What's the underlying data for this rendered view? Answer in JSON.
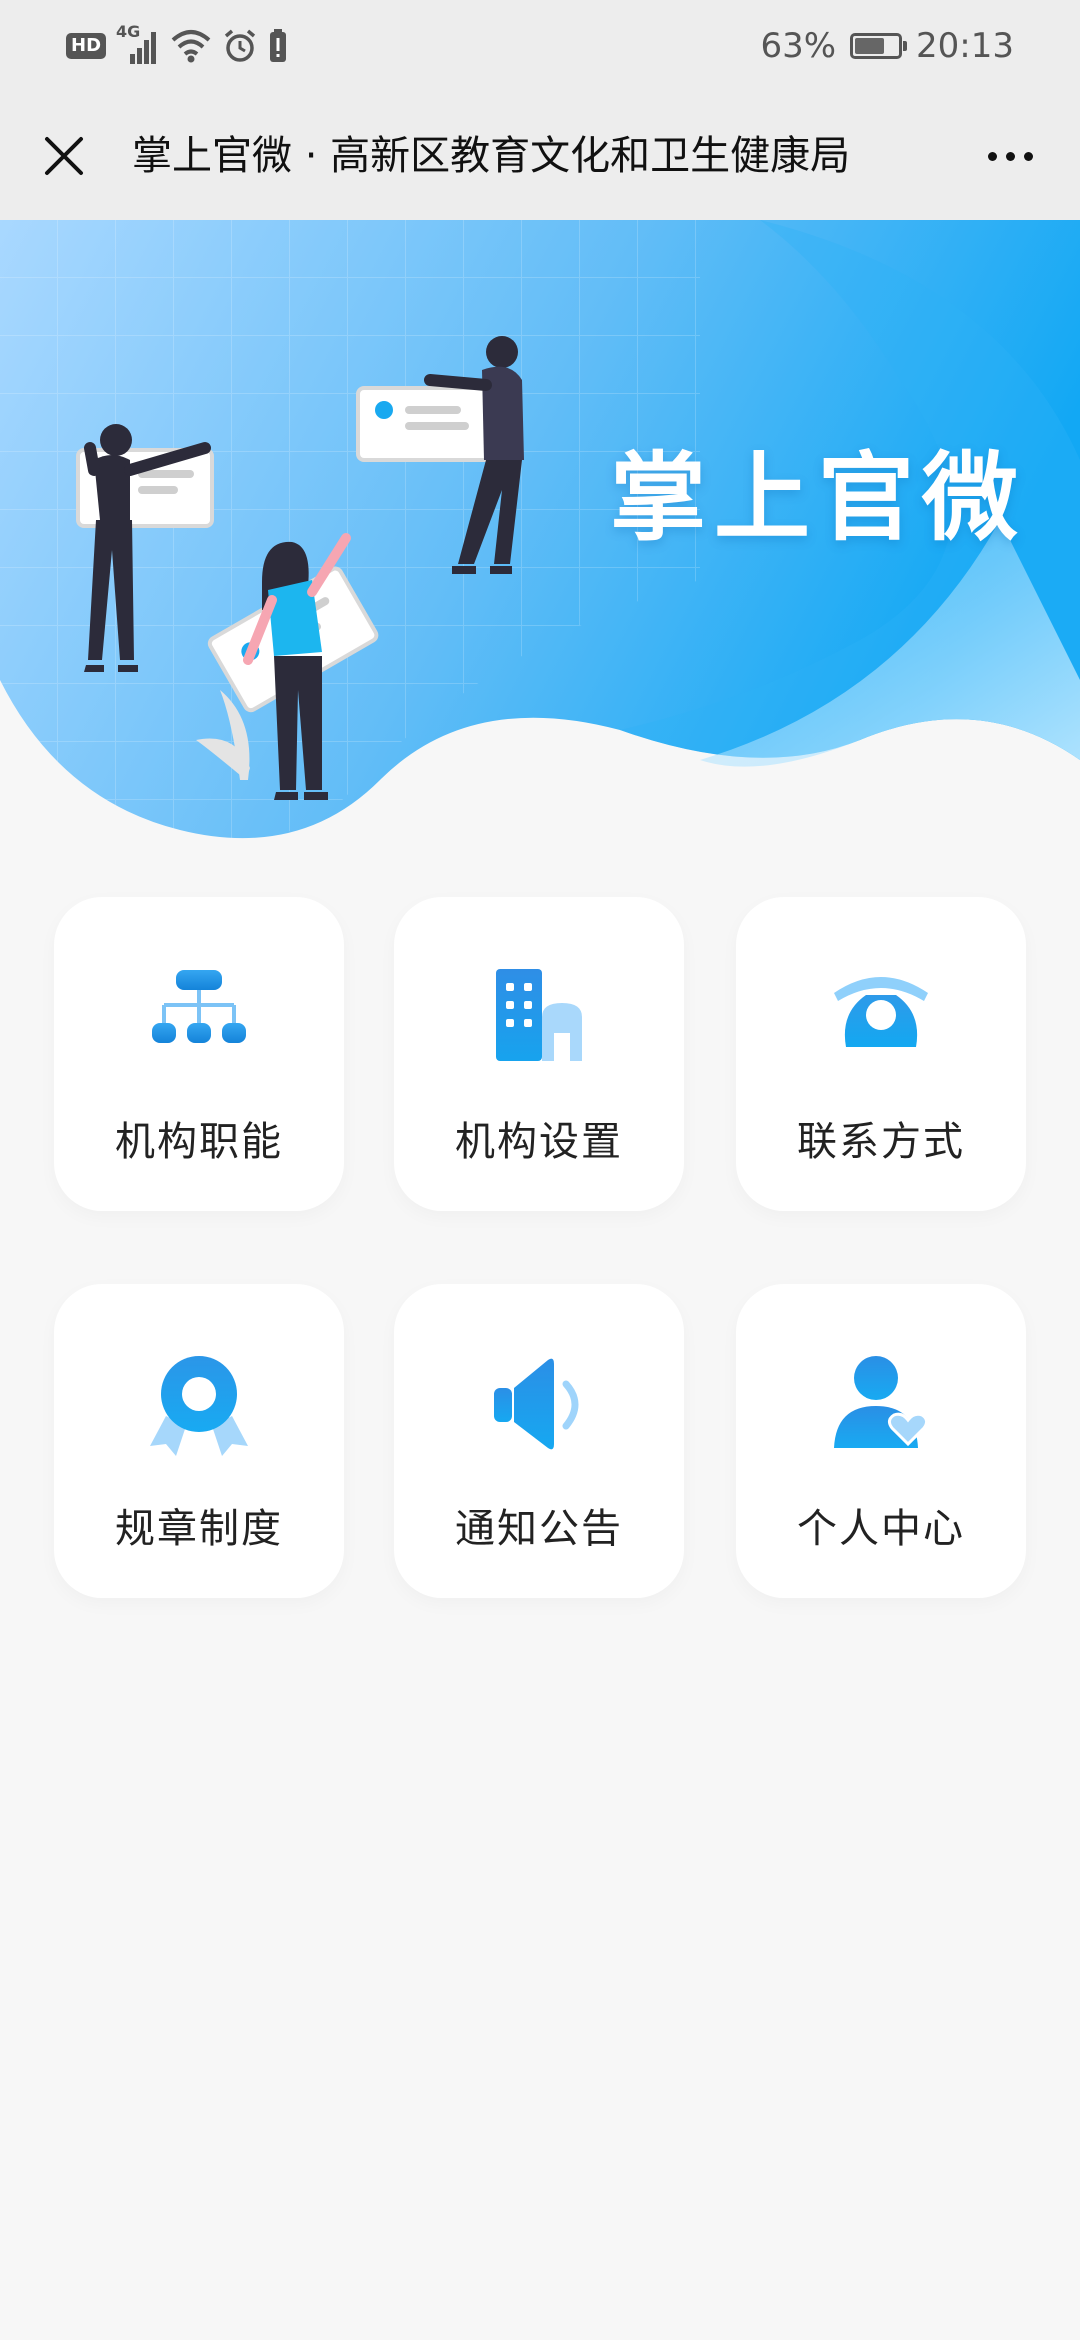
{
  "status_bar": {
    "network_badge": "HD",
    "network_type": "4G",
    "battery_percent": "63%",
    "battery_level": 0.63,
    "time": "20:13"
  },
  "header": {
    "title": "掌上官微 · 高新区教育文化和卫生健康局",
    "close_icon": "close-icon",
    "more_icon": "more-dots-icon"
  },
  "banner": {
    "title": "掌上官微"
  },
  "menu": [
    {
      "label": "机构职能",
      "icon": "org-chart-icon"
    },
    {
      "label": "机构设置",
      "icon": "buildings-icon"
    },
    {
      "label": "联系方式",
      "icon": "telephone-icon"
    },
    {
      "label": "规章制度",
      "icon": "award-badge-icon"
    },
    {
      "label": "通知公告",
      "icon": "megaphone-icon"
    },
    {
      "label": "个人中心",
      "icon": "user-heart-icon"
    }
  ],
  "colors": {
    "accent": "#1a9be8",
    "accent_light": "#8fd0fb",
    "banner_start": "#a7d6ff",
    "banner_end": "#12a9f5"
  }
}
